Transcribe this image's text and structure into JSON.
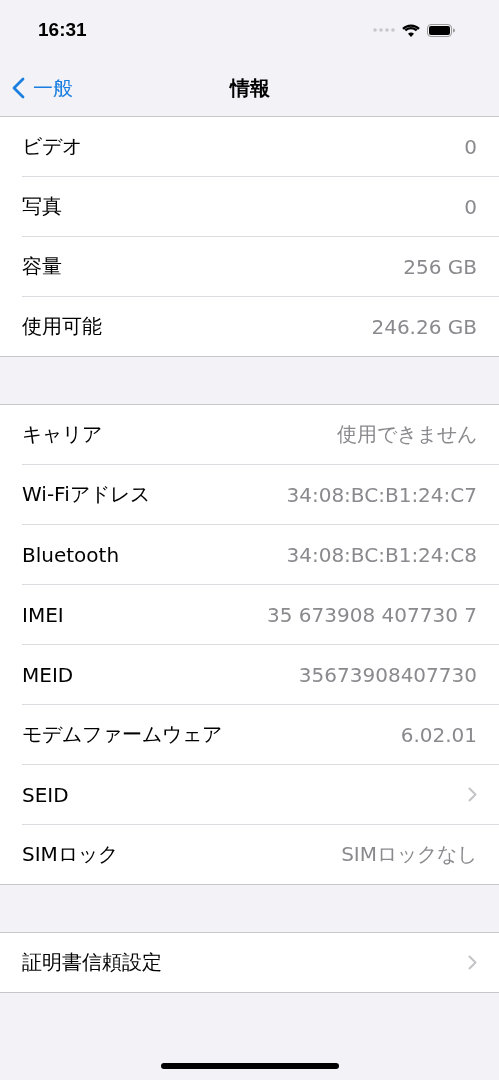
{
  "status_bar": {
    "time": "16:31"
  },
  "nav": {
    "back_label": "一般",
    "title": "情報"
  },
  "groups": [
    {
      "rows": [
        {
          "kind": "value",
          "label": "ビデオ",
          "value": "0"
        },
        {
          "kind": "value",
          "label": "写真",
          "value": "0"
        },
        {
          "kind": "value",
          "label": "容量",
          "value": "256 GB"
        },
        {
          "kind": "value",
          "label": "使用可能",
          "value": "246.26 GB"
        }
      ]
    },
    {
      "rows": [
        {
          "kind": "value",
          "label": "キャリア",
          "value": "使用できません"
        },
        {
          "kind": "value",
          "label": "Wi-Fiアドレス",
          "value": "34:08:BC:B1:24:C7"
        },
        {
          "kind": "value",
          "label": "Bluetooth",
          "value": "34:08:BC:B1:24:C8"
        },
        {
          "kind": "value",
          "label": "IMEI",
          "value": "35 673908 407730 7"
        },
        {
          "kind": "value",
          "label": "MEID",
          "value": "35673908407730"
        },
        {
          "kind": "value",
          "label": "モデムファームウェア",
          "value": "6.02.01"
        },
        {
          "kind": "chevron",
          "label": "SEID"
        },
        {
          "kind": "value",
          "label": "SIMロック",
          "value": "SIMロックなし"
        }
      ]
    },
    {
      "rows": [
        {
          "kind": "chevron",
          "label": "証明書信頼設定"
        }
      ]
    }
  ]
}
